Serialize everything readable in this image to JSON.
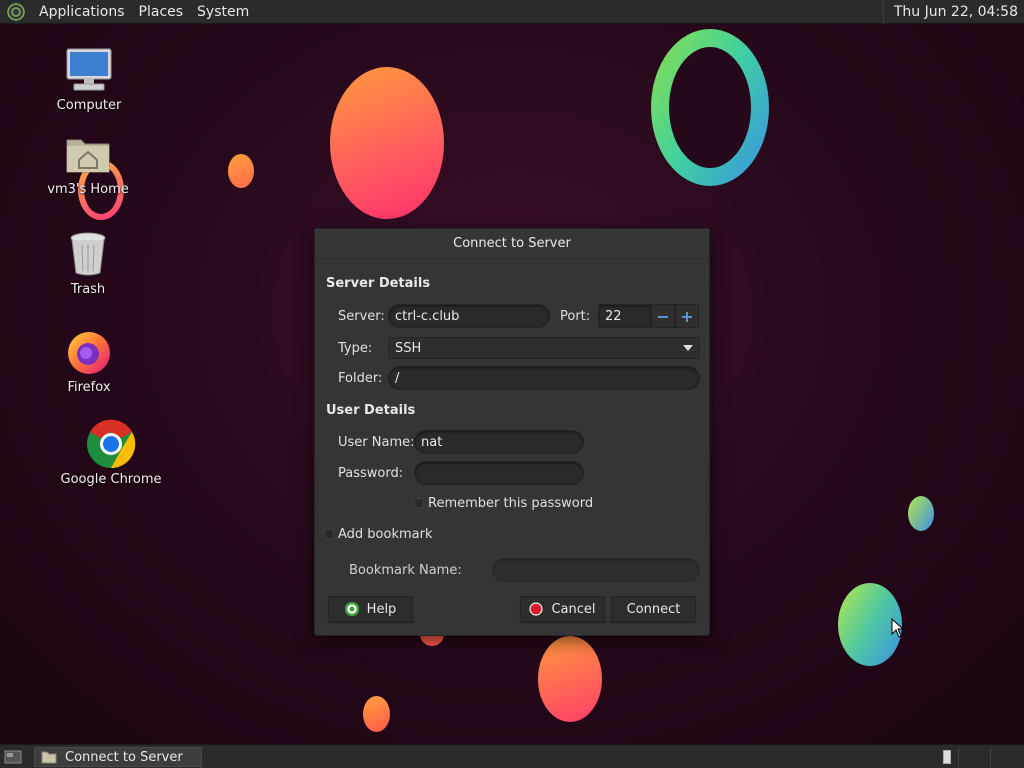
{
  "top_panel": {
    "menus": [
      "Applications",
      "Places",
      "System"
    ],
    "clock": "Thu Jun 22, 04:58"
  },
  "desktop_icons": [
    {
      "label": "Computer",
      "icon": "computer-icon"
    },
    {
      "label": "vm3's Home",
      "icon": "home-folder-icon"
    },
    {
      "label": "Trash",
      "icon": "trash-icon"
    },
    {
      "label": "Firefox",
      "icon": "firefox-icon"
    },
    {
      "label": "Google Chrome",
      "icon": "chrome-icon"
    }
  ],
  "dialog": {
    "title": "Connect to Server",
    "server_details_heading": "Server Details",
    "server_label": "Server:",
    "server_value": "ctrl-c.club",
    "port_label": "Port:",
    "port_value": "22",
    "type_label": "Type:",
    "type_value": "SSH",
    "folder_label": "Folder:",
    "folder_value": "/",
    "user_details_heading": "User Details",
    "username_label": "User Name:",
    "username_value": "nat",
    "password_label": "Password:",
    "password_value": "",
    "remember_label": "Remember this password",
    "add_bookmark_label": "Add bookmark",
    "bookmark_name_label": "Bookmark Name:",
    "bookmark_name_value": "",
    "help_label": "Help",
    "cancel_label": "Cancel",
    "connect_label": "Connect"
  },
  "taskbar": {
    "task_label": "Connect to Server"
  },
  "colors": {
    "accent": "#5b9bd5",
    "cancel_red": "#d81b2b",
    "help_green": "#3ca03c"
  }
}
